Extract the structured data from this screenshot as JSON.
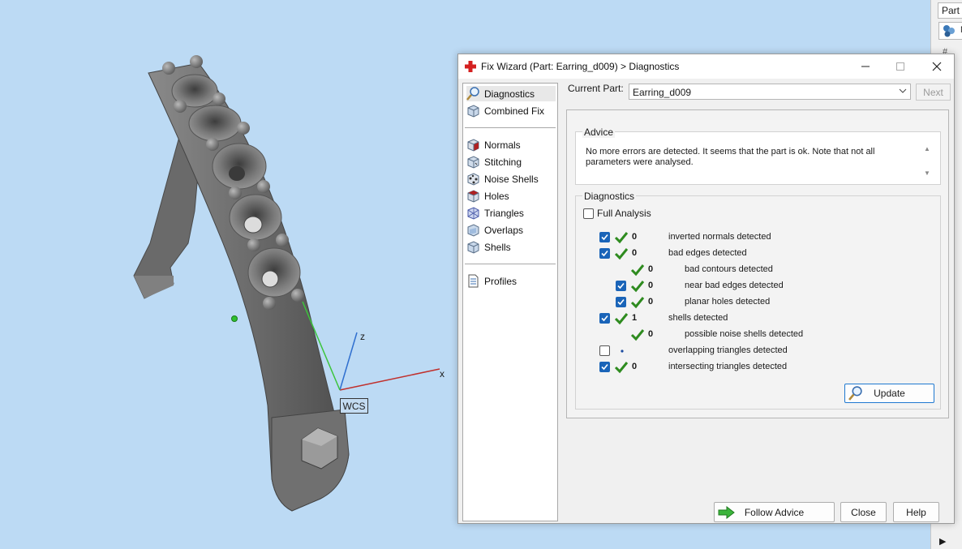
{
  "viewport": {
    "wcs_label": "WCS",
    "axis_x": "x",
    "axis_z": "z"
  },
  "side_panel": {
    "tab_label": "Part",
    "button_label": "M",
    "hash": "#"
  },
  "dialog": {
    "title": "Fix Wizard (Part: Earring_d009) > Diagnostics",
    "nav": {
      "group1": [
        {
          "label": "Diagnostics",
          "icon": "magnifier-icon",
          "selected": true
        },
        {
          "label": "Combined Fix",
          "icon": "cube-icon"
        }
      ],
      "group2": [
        {
          "label": "Normals",
          "icon": "cube-red-icon"
        },
        {
          "label": "Stitching",
          "icon": "cube-stitch-icon"
        },
        {
          "label": "Noise Shells",
          "icon": "cube-noise-icon"
        },
        {
          "label": "Holes",
          "icon": "cube-hole-icon"
        },
        {
          "label": "Triangles",
          "icon": "cube-triangles-icon"
        },
        {
          "label": "Overlaps",
          "icon": "cube-overlap-icon"
        },
        {
          "label": "Shells",
          "icon": "cube-shell-icon"
        }
      ],
      "group3": [
        {
          "label": "Profiles",
          "icon": "document-icon"
        }
      ]
    },
    "current_part_label": "Current Part:",
    "current_part_value": "Earring_d009",
    "next_label": "Next",
    "advice": {
      "title": "Advice",
      "text": "No more errors are detected. It seems that the part is ok. Note that not all parameters were analysed."
    },
    "diagnostics": {
      "title": "Diagnostics",
      "full_analysis_label": "Full Analysis",
      "full_analysis_checked": false,
      "rows": [
        {
          "checkbox": "on",
          "status": "ok",
          "count": "0",
          "label": "inverted normals detected",
          "indent": 0
        },
        {
          "checkbox": "on",
          "status": "ok",
          "count": "0",
          "label": "bad edges detected",
          "indent": 0
        },
        {
          "checkbox": "none",
          "status": "ok",
          "count": "0",
          "label": "bad contours detected",
          "indent": 1
        },
        {
          "checkbox": "on",
          "status": "ok",
          "count": "0",
          "label": "near bad edges detected",
          "indent": 1
        },
        {
          "checkbox": "on",
          "status": "ok",
          "count": "0",
          "label": "planar holes detected",
          "indent": 1
        },
        {
          "checkbox": "on",
          "status": "ok",
          "count": "1",
          "label": "shells detected",
          "indent": 0
        },
        {
          "checkbox": "none",
          "status": "ok",
          "count": "0",
          "label": "possible noise shells detected",
          "indent": 1
        },
        {
          "checkbox": "off",
          "status": "dot",
          "count": "",
          "label": "overlapping triangles detected",
          "indent": 0
        },
        {
          "checkbox": "on",
          "status": "ok",
          "count": "0",
          "label": "intersecting triangles detected",
          "indent": 0
        }
      ],
      "update_label": "Update"
    },
    "buttons": {
      "follow_advice": "Follow Advice",
      "close": "Close",
      "help": "Help"
    }
  },
  "colors": {
    "viewport_bg": "#bcdaf4",
    "model": "#6e6e6e",
    "check_green": "#2e8b1f",
    "checkbox_blue": "#1a64b8",
    "axis_x": "#c0302c",
    "axis_z": "#2f6fcf",
    "axis_green": "#3cc43c"
  }
}
